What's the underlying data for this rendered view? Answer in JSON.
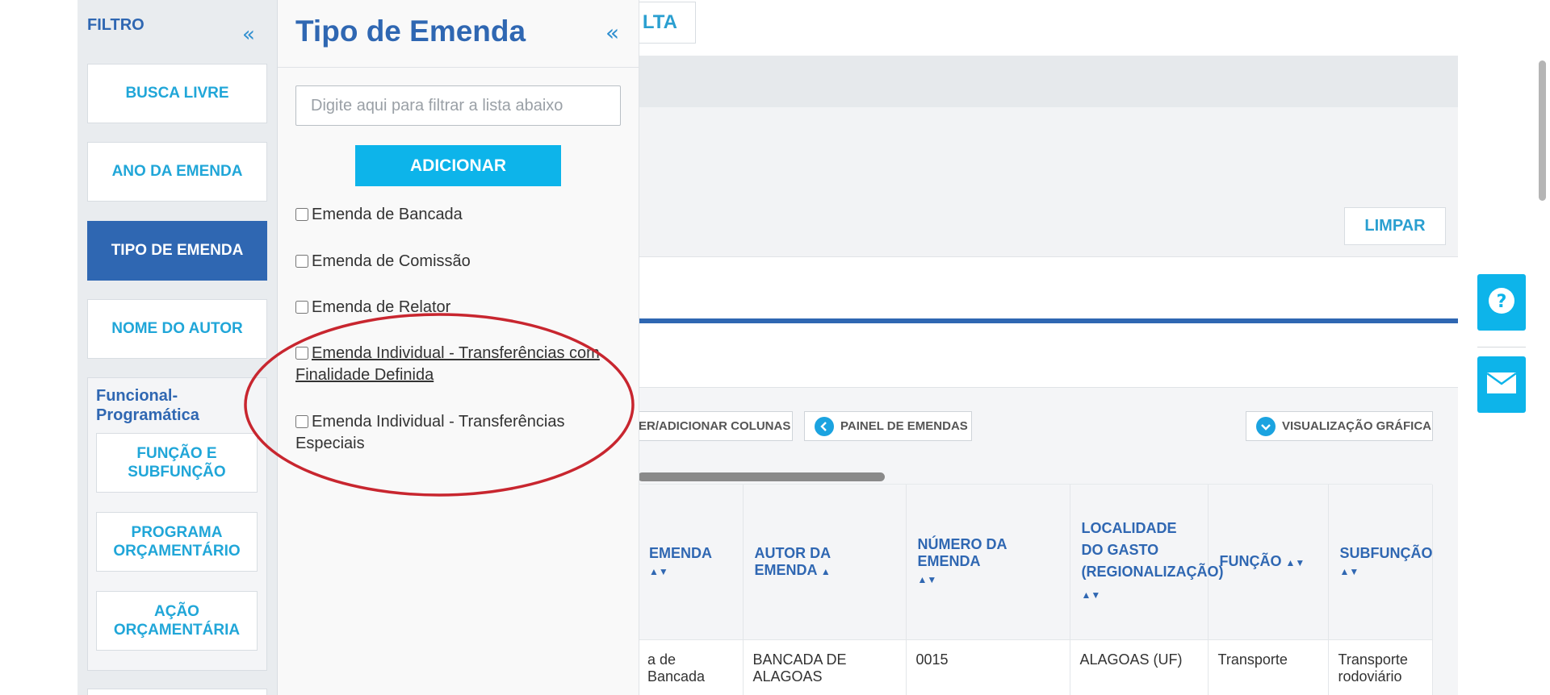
{
  "bg": {
    "top_button_label": "LTA",
    "limpar_label": "LIMPAR",
    "toolbar": {
      "columns_label": "ER/ADICIONAR COLUNAS",
      "painel_label": "PAINEL DE EMENDAS",
      "grafica_label": "VISUALIZAÇÃO GRÁFICA"
    },
    "table": {
      "headers": [
        "EMENDA",
        "AUTOR DA EMENDA",
        "NÚMERO DA EMENDA",
        "LOCALIDADE DO GASTO (REGIONALIZAÇÃO)",
        "FUNÇÃO",
        "SUBFUNÇÃO"
      ],
      "row": [
        "a de Bancada",
        "BANCADA DE ALAGOAS",
        "0015",
        "ALAGOAS (UF)",
        "Transporte",
        "Transporte rodoviário"
      ]
    }
  },
  "filter": {
    "title": "FILTRO",
    "collapse_icon": "«",
    "buttons": [
      "BUSCA LIVRE",
      "ANO DA EMENDA",
      "TIPO DE EMENDA",
      "NOME DO AUTOR"
    ],
    "active_index": 2,
    "group": {
      "title": "Funcional-Programática",
      "items": [
        "FUNÇÃO E SUBFUNÇÃO",
        "PROGRAMA ORÇAMENTÁRIO",
        "AÇÃO ORÇAMENTÁRIA"
      ]
    }
  },
  "tipo": {
    "title": "Tipo de Emenda",
    "collapse_icon": "«",
    "input_placeholder": "Digite aqui para filtrar a lista abaixo",
    "add_label": "ADICIONAR",
    "options": [
      "Emenda de Bancada",
      "Emenda de Comissão",
      "Emenda de Relator",
      "Emenda Individual - Transferências com Finalidade Definida",
      "Emenda Individual - Transferências Especiais"
    ]
  },
  "icons": {
    "help": "question-icon",
    "mail": "envelope-icon",
    "chevron_left": "chevron-left-icon",
    "chevron_down": "chevron-down-icon"
  },
  "colors": {
    "primary_blue": "#2f67b2",
    "accent_cyan": "#0db4ea",
    "annotation_red": "#c8262f"
  }
}
